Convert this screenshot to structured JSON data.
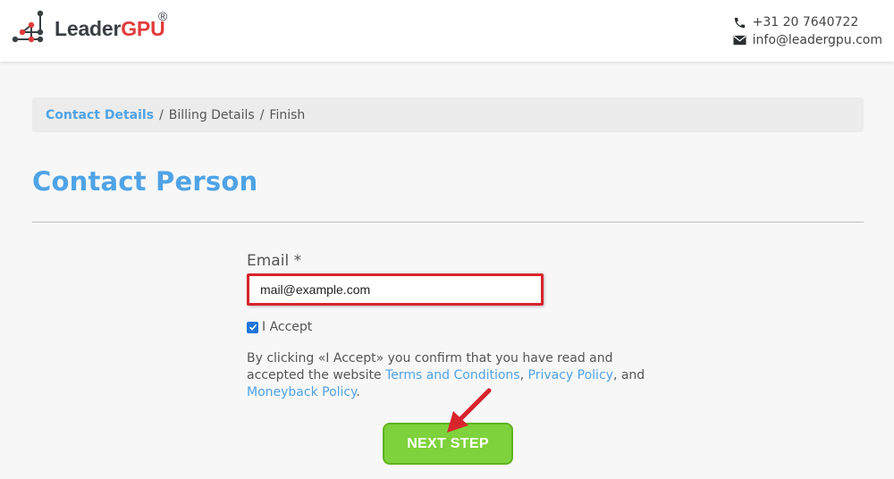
{
  "header": {
    "logo": {
      "name_part1": "Leader",
      "name_part2": "GPU",
      "registered": "®"
    },
    "phone": "+31 20 7640722",
    "email": "info@leadergpu.com"
  },
  "breadcrumb": {
    "items": [
      "Contact Details",
      "Billing Details",
      "Finish"
    ],
    "separator": "/"
  },
  "page": {
    "title": "Contact Person"
  },
  "form": {
    "email_label": "Email *",
    "email_value": "mail@example.com",
    "accept_label": "I Accept",
    "terms": {
      "prefix": "By clicking «I Accept» you confirm that you have read and accepted the website ",
      "link1": "Terms and Conditions",
      "comma": ", ",
      "link2": "Privacy Policy",
      "and": ", and ",
      "link3": "Moneyback Policy",
      "suffix": "."
    },
    "next_label": "NEXT STEP"
  },
  "colors": {
    "accent": "#4fa3e6",
    "brand_red": "#e23b3b",
    "button_green": "#7ed23b",
    "highlight_red": "#d9232d"
  },
  "icons": {
    "phone": "phone-icon",
    "mail": "envelope-icon",
    "check": "checkmark-icon",
    "arrow": "annotation-arrow-icon"
  }
}
